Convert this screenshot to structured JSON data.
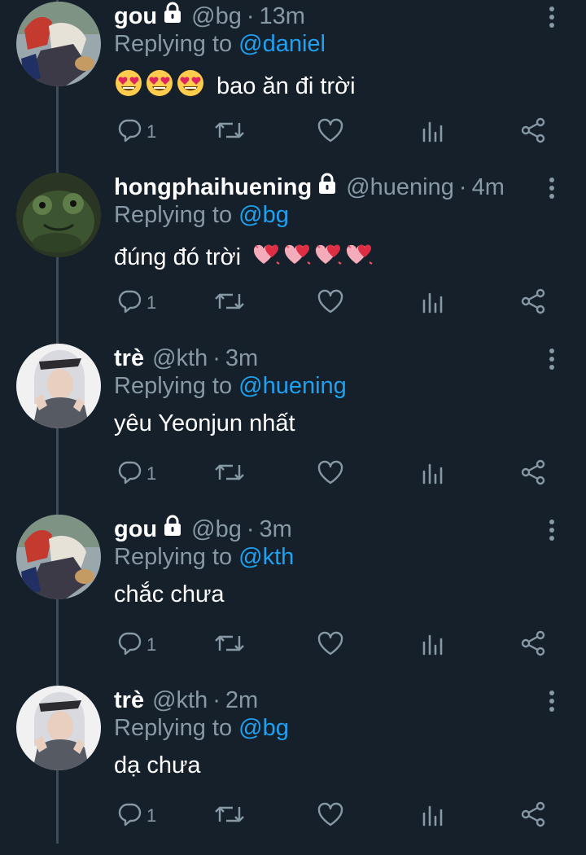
{
  "tweets": [
    {
      "name": "gou",
      "locked": true,
      "handle": "@bg",
      "time": "13m",
      "replying_label": "Replying to",
      "replying_to": "@daniel",
      "text": "bao ăn đi trời",
      "emojis_before": [
        "heart-eyes-emoji",
        "heart-eyes-emoji",
        "heart-eyes-emoji"
      ],
      "emojis_after": [],
      "avatar": "cartoon-avatar",
      "reply_count": "1"
    },
    {
      "name": "hongphaihuening",
      "locked": true,
      "handle": "@huening",
      "time": "4m",
      "replying_label": "Replying to",
      "replying_to": "@bg",
      "text": "đúng đó trời",
      "emojis_before": [],
      "emojis_after": [
        "hearts-emoji",
        "hearts-emoji",
        "hearts-emoji",
        "hearts-emoji"
      ],
      "avatar": "frog-avatar",
      "reply_count": "1"
    },
    {
      "name": "trè",
      "locked": false,
      "handle": "@kth",
      "time": "3m",
      "replying_label": "Replying to",
      "replying_to": "@huening",
      "text": "yêu Yeonjun nhất",
      "emojis_before": [],
      "emojis_after": [],
      "avatar": "person-avatar",
      "reply_count": "1"
    },
    {
      "name": "gou",
      "locked": true,
      "handle": "@bg",
      "time": "3m",
      "replying_label": "Replying to",
      "replying_to": "@kth",
      "text": "chắc chưa",
      "emojis_before": [],
      "emojis_after": [],
      "avatar": "cartoon-avatar",
      "reply_count": "1"
    },
    {
      "name": "trè",
      "locked": false,
      "handle": "@kth",
      "time": "2m",
      "replying_label": "Replying to",
      "replying_to": "@bg",
      "text": "dạ chưa",
      "emojis_before": [],
      "emojis_after": [],
      "avatar": "person-avatar",
      "reply_count": "1"
    }
  ],
  "dot": "·",
  "colors": {
    "background": "#15202b",
    "muted": "#8899a6",
    "link": "#1da1f2",
    "thread_line": "#3d4c5a"
  }
}
